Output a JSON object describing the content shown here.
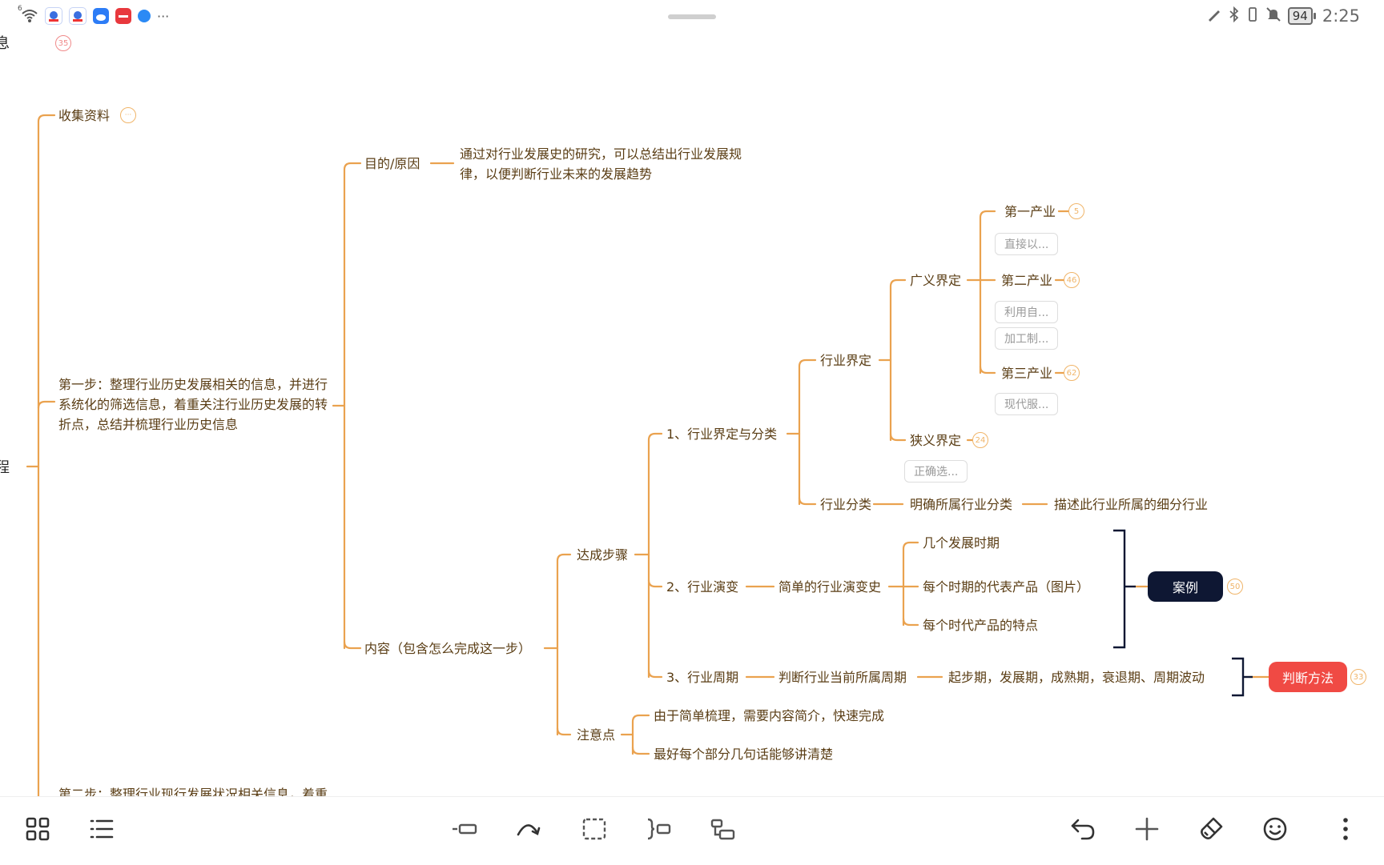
{
  "status_bar": {
    "left_icons": [
      "wifi-icon",
      "app-icon-1",
      "app-icon-2",
      "cloud-app-icon",
      "red-app-icon",
      "blue-app-icon",
      "more-dots-icon"
    ],
    "wifi_label": "6",
    "more_label": "···",
    "right_icons": [
      "stylus-icon",
      "bluetooth-icon",
      "vibrate-icon",
      "mute-icon"
    ],
    "battery": "94",
    "time": "2:25"
  },
  "mindmap": {
    "left_edge": {
      "top_char": "息",
      "mid_char": "程",
      "top_badge": "35"
    },
    "collect": {
      "label": "收集资料",
      "badge": "···"
    },
    "step1": {
      "label": "第一步：整理行业历史发展相关的信息，并进行系统化的筛选信息，着重关注行业历史发展的转折点，总结并梳理行业历史信息"
    },
    "purpose": {
      "label": "目的/原因",
      "text": "通过对行业发展史的研究，可以总结出行业发展规律，以便判断行业未来的发展趋势"
    },
    "content": {
      "label": "内容（包含怎么完成这一步）"
    },
    "steps": {
      "label": "达成步骤"
    },
    "notes": {
      "label": "注意点",
      "items": [
        "由于简单梳理，需要内容简介，快速完成",
        "最好每个部分几句话能够讲清楚"
      ]
    },
    "s1": {
      "label": "1、行业界定与分类"
    },
    "define": {
      "label": "行业界定"
    },
    "broad": {
      "label": "广义界定"
    },
    "primary": {
      "label": "第一产业",
      "badge": "5",
      "pill": "直接以..."
    },
    "secondary": {
      "label": "第二产业",
      "badge": "46",
      "pills": [
        "利用自...",
        "加工制..."
      ]
    },
    "tertiary": {
      "label": "第三产业",
      "badge": "62",
      "pill": "现代服..."
    },
    "narrow": {
      "label": "狭义界定",
      "badge": "24",
      "pill": "正确选..."
    },
    "classify": {
      "label": "行业分类",
      "mid": "明确所属行业分类",
      "end": "描述此行业所属的细分行业"
    },
    "s2": {
      "label": "2、行业演变",
      "mid": "简单的行业演变史",
      "items": [
        "几个发展时期",
        "每个时期的代表产品（图片）",
        "每个时代产品的特点"
      ],
      "tag": "案例",
      "badge": "50"
    },
    "s3": {
      "label": "3、行业周期",
      "mid": "判断行业当前所属周期",
      "end": "起步期，发展期，成熟期，衰退期、周期波动",
      "tag": "判断方法",
      "badge": "33"
    },
    "step2_partial": {
      "label": "第二步：整理行业现行发展状况相关信息，着重"
    }
  },
  "toolbar": {
    "left": [
      "grid-view-icon",
      "outline-list-icon"
    ],
    "center": [
      "insert-topic-icon",
      "connect-curve-icon",
      "boundary-icon",
      "summary-icon",
      "subtopic-icon"
    ],
    "right": [
      "undo-icon",
      "add-icon",
      "format-brush-icon",
      "emoji-icon",
      "more-icon"
    ]
  },
  "colors": {
    "line": "#eaa24f",
    "text": "#5a3d14",
    "tag_dark": "#0e1733",
    "tag_red": "#f04a44"
  }
}
